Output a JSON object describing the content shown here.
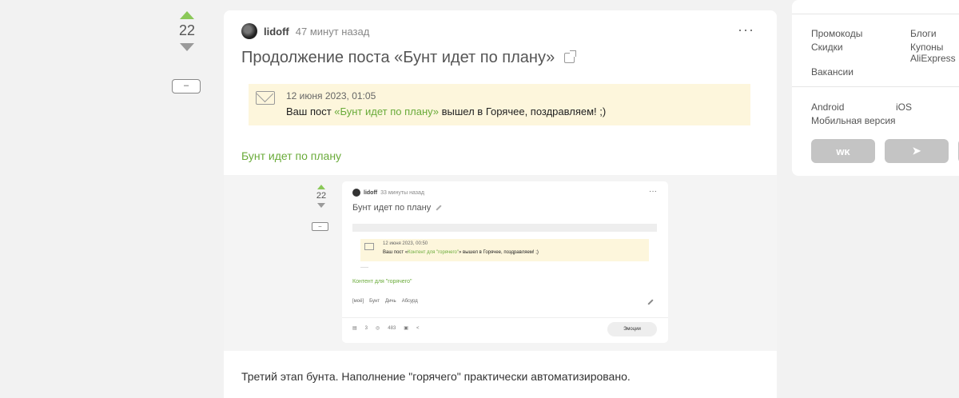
{
  "vote": {
    "count": "22",
    "collapse_label": "–"
  },
  "post": {
    "author": "lidoff",
    "time": "47 минут назад",
    "menu": "···",
    "title": "Продолжение поста «Бунт идет по плану»",
    "notice": {
      "date": "12 июня 2023, 01:05",
      "text_before": "Ваш пост ",
      "link": "«Бунт идет по плану»",
      "text_after": " вышел в Горячее, поздравляем! ;)"
    },
    "link_text": "Бунт идет по плану",
    "body": "Третий этап бунта. Наполнение \"горячего\" практически автоматизировано."
  },
  "embedded": {
    "vote_count": "22",
    "collapse_label": "–",
    "author": "lidoff",
    "time": "33 минуты назад",
    "menu": "···",
    "title": "Бунт идет по плану",
    "notice": {
      "date": "12 июня 2023, 00:50",
      "text_before": "Ваш пост «",
      "link": "Контент для \"горячего\"",
      "text_after": "» вышел в Горячее, поздравляем! ;)"
    },
    "link_text": "Контент для \"горячего\"",
    "tags": [
      "[моё]",
      "Бунт",
      "Дичь",
      "Абсурд"
    ],
    "comments": "3",
    "views": "483",
    "emotions": "Эмоции"
  },
  "sidebar": {
    "links1": [
      "Промокоды",
      "Блоги",
      "Скидки",
      "Купоны AliExpress",
      "Вакансии"
    ],
    "links2": [
      "Android",
      "iOS",
      "Мобильная версия"
    ],
    "social": [
      "vk",
      "telegram",
      ""
    ]
  }
}
